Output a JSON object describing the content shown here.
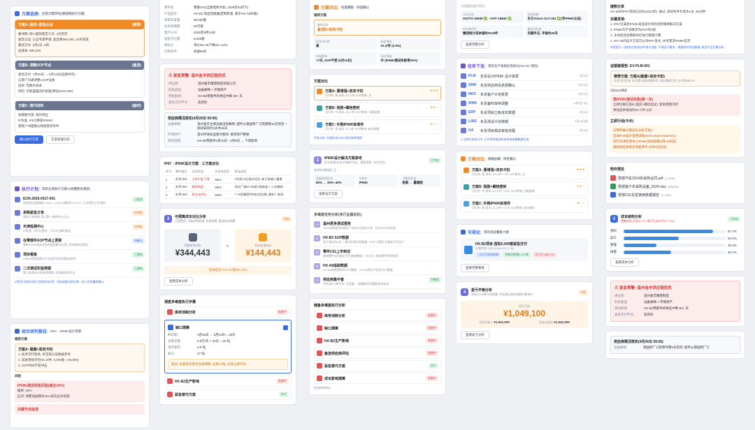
{
  "col1": {
    "schemes": {
      "title": "方案选择:",
      "subtitle": "应急方案评估(请选择执行方案)",
      "a": {
        "title": "方案A: 稳定+紧急认证",
        "badge": "(推荐)",
        "items": [
          "缓冲期: 四川晨阳稳定三天, 2天到货",
          "紧急认证: 认证专家申请, 加急费¥50,000, 30天完成",
          "最佳交付: 6月1日, 5周",
          "总成本: ¥80,200"
        ]
      },
      "b": {
        "title": "方案B: 调整SOP节点",
        "badge": "(备选)",
        "items": [
          "紧急交付: 7月30日 → 8月15日(延期半月)",
          "与客户沟通调整LSOP设备",
          "成本: 无额外成本",
          "风险: 可能面临违约索赔(预估¥100,000)"
        ]
      },
      "c": {
        "title": "方案C: 替代材料",
        "badge": "(临时)",
        "items": [
          "短期替代源: 海外供应",
          "IP标准: IP67(降级IP69K)",
          "需客户书面确认降级接受条件"
        ]
      },
      "confirm": "确认执行方案",
      "compare": "方案智能比较"
    },
    "tasks": {
      "title": "执行计划:",
      "subtitle": "项目立项执行方案A(如需更多请求)",
      "items": [
        {
          "name": "ECN-2026-0317-001",
          "desc": "热处理过程规格(0.6mm→0.5mm)需进ECR-001, 工艺规范工艺流程",
          "badge": "已批准",
          "color": "bg-green"
        },
        {
          "name": "采购紧急订单",
          "desc": "紧急订单采购-用于第一批样件(3.5万)",
          "badge": "待审批",
          "color": "bg-orange"
        },
        {
          "name": "天津检测中心",
          "desc": "IP检测: 7月6日提测 · 7月25日拿到报告",
          "badge": "待审批",
          "color": "bg-orange"
        },
        {
          "name": "在零部件SOP节点上更新",
          "desc": "更新IP69K测试计划并组织解决方案, 评估影响后提交",
          "badge": "待确认",
          "color": "bg-blue"
        },
        {
          "name": "项目看板",
          "desc": "IP69K测试结果对于外协件发货的影响说明",
          "badge": "已更新",
          "color": "bg-green"
        },
        {
          "name": "二次测试实验排期",
          "desc": "第二轮测试计划安排排期, 验证新检测方法",
          "badge": "已更新",
          "color": "bg-green"
        }
      ],
      "footer": "#项目已经执行的已完成任务3项 · 总体进度当前计划 · 进入完成最终确认"
    },
    "report": {
      "title": "综合研判报告:",
      "subtitle": "IP67→IP69K设计变更",
      "rec_label": "推荐方案",
      "rec_title": "方案A: 稳健+双向卡扣",
      "rec_items": [
        "1. 技术可行性高, 有实际认证数据参考",
        "2. 成本增加可控(¥1.2/件, 5,000套 ≈ ¥6,000)",
        "3. SOP时间不受冲击"
      ],
      "risk_label": "风险",
      "risk1_title": "IP69K测试失败风险(高达20%)",
      "risk1_items": [
        "概率: 20%",
        "应对: 调整加固模块40%成功应对措施"
      ],
      "risk2_title": "关键节点延误"
    }
  },
  "col2": {
    "params": [
      {
        "k": "零件名",
        "v": "零部C01(全新结构卡扣, 2026年01月下)"
      },
      {
        "k": "产品型号",
        "v": "HX-B2 高压连接器(定制开发, 基于HX-A8升级)"
      },
      {
        "k": "项目年度量",
        "v": "80,000套"
      },
      {
        "k": "生命周期量",
        "v": "50万套"
      },
      {
        "k": "量产SOP",
        "v": "2026年8月15日"
      },
      {
        "k": "首批交付量",
        "v": "5,000套"
      },
      {
        "k": "目标价",
        "v": "单价¥X-A8下降5%~12%"
      },
      {
        "k": "付款条件",
        "v": "验收60天"
      }
    ],
    "alert": {
      "title": "紧急预警: 温州金丰供应链危机",
      "rows": [
        {
          "k": "供应商:",
          "v": "温州金丰精密制造有限公司"
        },
        {
          "k": "危机类型:",
          "v": "设备故障 + 环保停产"
        },
        {
          "k": "预估影响:",
          "v": "HX-B2零部件的供应中断 50+ 天"
        },
        {
          "k": "紧急交付节点:",
          "v": "高风险"
        }
      ]
    },
    "status": {
      "title": "供应商情况核实(4月26日 09:05)",
      "rows": [
        {
          "k": "设备故障:",
          "v": "温州金丰主要设备出现故障, 配件从德国原厂订购需要15天到货 + 调试安装约3天共36天"
        },
        {
          "k": "环保停产:",
          "v": "温州环保局监管令暂停, 要求停产整顿"
        },
        {
          "k": "影响范围:",
          "v": "HX-B2零部件4月19日 · 5月6日 → 下线影响"
        }
      ]
    },
    "compare": {
      "title": "IP67→IP69K设计方案 · 三方案对比",
      "headers": [
        "序号",
        "零件编号",
        "当前状态",
        "供应商类型",
        "影响说明"
      ],
      "rows": [
        [
          "1",
          "外壳-001",
          "主体产能下滑",
          "MEG",
          "4号线+0主线口径异, 新订单输入量增"
        ],
        [
          "2",
          "外壳-002",
          "精密铸造",
          "MEG",
          "四太厂调M-A6进行装饰面 + 二次精修"
        ],
        [
          "3",
          "外壳-003",
          "原全成供应",
          "MRG",
          "广州铝精密件供料交货期, 需补7, 新采"
        ]
      ]
    },
    "cost": {
      "num": "3",
      "title": "与预算成本对比分析",
      "subtitle": "主要费用: 设备采购新增, 质量预算, 管理成本预算",
      "badge": "待定",
      "budget_label": "预算参考成本",
      "budget": "¥344,443",
      "actual_label": "实际变更成本",
      "actual": "¥144,443",
      "diff": "成本超支 ¥44.29/套(84.4%)",
      "btn": "查看成本分析"
    },
    "flow": {
      "title": "调度多维度执行步骤",
      "steps": [
        {
          "name": "库存消耗分析",
          "badge": "准备中",
          "color": "bg-red"
        },
        {
          "name": "缺口测算",
          "badge": "",
          "color": "bg-blue"
        }
      ],
      "detail": [
        {
          "k": "断料期:",
          "v": "4月26日 → 6月10日 = 30天"
        },
        {
          "k": "总需求量:",
          "v": "0.9万/天 × 33天 = 30 吨"
        },
        {
          "k": "现有库存:",
          "v": "3.0 吨"
        },
        {
          "k": "缺口:",
          "v": "27 吨"
        }
      ],
      "warn": "建议: 恢复现有库存设备预期, 启始17吨, 必须立即行动",
      "more": [
        {
          "name": "HX-B2生产影响",
          "badge": "准备中",
          "color": "bg-red"
        },
        {
          "name": "紧急替代方案",
          "badge": "执行",
          "color": "bg-green"
        }
      ]
    }
  },
  "col3": {
    "compare": {
      "title": "方案对比:",
      "subtitle": "标准模板 · 待选确认",
      "rec_label": "推荐方案",
      "rec_box": "备份设计",
      "rec_box2": "备选B+双向卡扣",
      "cells": [
        {
          "k": "技术可行性",
          "v": "高"
        },
        {
          "k": "成本增加",
          "v": "¥1.2/件 (3.0%)"
        },
        {
          "k": "时间影响",
          "v": "+7天, SOP不受 (5月15日)"
        },
        {
          "k": "风险等级",
          "v": "中 (IP69K测试失败率20%)"
        }
      ]
    },
    "options": {
      "title": "方案对比",
      "items": [
        {
          "name": "方案A: 重增强+双向卡扣",
          "meta": "可行性: 高  成本: ¥1.2/件  SOP影响: 无",
          "stars": "★★★",
          "hl": true
        },
        {
          "name": "方案B: 硅胶+螺栓密封",
          "meta": "可行性: 中  成本: ¥1.2/件  SOP影响: 可能延期",
          "stars": "★★☆",
          "hl": false
        },
        {
          "name": "方案C: 外购IP69K标准件",
          "meta": "可行性: 高  成本: ¥1.5件  SOP影响: 成本规模",
          "stars": "★☆☆",
          "hl": false
        }
      ],
      "link": "开发分析: 扫描车风IP69K项目参考案例"
    },
    "design": {
      "num": "1",
      "title": "IP69K设计解决方案参考",
      "subtitle": "四大来源(车风/外链研讨会)  · 直接采购  · 技术文档",
      "badge": "已完成",
      "ref_label": "参考检测数据汇总",
      "cells": [
        {
          "k": "温度测试区间",
          "v": "80% → 30%~40%"
        },
        {
          "k": "IP防护",
          "v": "IP69K"
        },
        {
          "k": "可靠性验证",
          "v": "组装 → 量端组"
        }
      ],
      "btn": "查看设计方案"
    },
    "steps": {
      "title": "多维度任务分析(多行业版对比)",
      "items": [
        {
          "n": "01",
          "name": "温州更多测试报告",
          "desc": "2026年新闻分析报告一体化2次测试分享 · 日均5K节点状态",
          "badge": ""
        },
        {
          "n": "02",
          "name": "HX-B2 SOP数据",
          "desc": "生产线8月15日 + 通过年到风险数据 · SOP 日期无为相关平均生产",
          "badge": ""
        },
        {
          "n": "03",
          "name": "零件C01上市到访",
          "desc": "查询零件访问报价平台查询数据 · 7月9日 | 现有零件等待检测",
          "badge": ""
        },
        {
          "n": "04",
          "name": "HX-A8追踪数据",
          "desc": "HX-A8研发期间可IP67数据 · HX-A8原生产验证IP67数据",
          "badge": ""
        },
        {
          "n": "05",
          "name": "供应商集中查",
          "desc": "中达4的订单平台, 可设备7 · 把握新资讯需要发布成本",
          "badge": "完整版"
        }
      ]
    },
    "analysis": {
      "title": "储备多维度执行分析",
      "items": [
        {
          "name": "库存消耗分析",
          "badge": "准备中",
          "color": "bg-red"
        },
        {
          "name": "缺口测算",
          "badge": "准备中",
          "color": "bg-red"
        },
        {
          "name": "HX-B2生产影响",
          "badge": "准备中",
          "color": "bg-red"
        },
        {
          "name": "备选供应商评估",
          "badge": "准备中",
          "color": "bg-red"
        },
        {
          "name": "紧急替代方案",
          "badge": "执行",
          "color": "bg-green"
        },
        {
          "name": "成本影响测算",
          "badge": "准备中",
          "color": "bg-red"
        }
      ],
      "footer": "综合研判结论"
    }
  },
  "col4": {
    "cert": {
      "title": "认证备案(国外项目)",
      "cells": [
        {
          "k": "认证状态",
          "v": "ISO/TS 16949 ✅ · IATF 16949 ✅"
        },
        {
          "k": "检测设备",
          "v": "东方Vision GLT-401 ✅(华IP69K认证)"
        },
        {
          "k": "供应商评估",
          "v": "集团统计成本值约¥0.8/件"
        },
        {
          "k": "最优供应商",
          "v": "无额外支, 平省约20天"
        }
      ],
      "btn": "查看完整分析"
    },
    "tasks": {
      "title": "任务下发:",
      "subtitle": "项目生产系统任务拆分(HX-B2 项目)",
      "items": [
        {
          "sys": "PLM",
          "desc": "负责设计IP69K 设计变更",
          "date": "6月5日"
        },
        {
          "sys": "SRM",
          "desc": "负责供应商信息部确认",
          "date": "5月15日"
        },
        {
          "sys": "MES",
          "desc": "负责客户计划变更",
          "date": "5月20日"
        },
        {
          "sys": "WMS",
          "desc": "负责备料库存调整",
          "date": "5月5日-9日"
        },
        {
          "sys": "ERP",
          "desc": "负责项目立新成本数据",
          "date": "5月4日"
        },
        {
          "sys": "LIMS",
          "desc": "负责测试计划排期",
          "date": "6月20日前"
        },
        {
          "sys": "OA",
          "desc": "负责项目相关审批流程",
          "date": "5月3日"
        }
      ],
      "footer": "# 当前任务执行中, 正在等待推送所有系统准确数据生效"
    },
    "compare2": {
      "title": "方案对比:",
      "subtitle": "稍候加载 · 待定确认",
      "items": [
        {
          "name": "方案A: 重增强+双向卡扣",
          "meta": "可行性: 高  成本: ¥1.2/件  +7天  SOP影响: 无",
          "stars": "★★★"
        },
        {
          "name": "方案B: 硅胶+螺栓密封",
          "meta": "可行性: 中  成本: ¥1.2/件  +14天  SOP影响: 可能延期",
          "stars": "★★☆"
        },
        {
          "name": "方案C: 外购IP69K标准件",
          "meta": "可行性: 高  成本: ¥1.5/件  +21天  SOP影响: 成本增长",
          "stars": "★☆☆"
        }
      ]
    },
    "viz": {
      "title": "可视化:",
      "subtitle": "项目发送看板大屏",
      "proj": "HX-B2项目·首批5,000套紧急交付",
      "meta": "计划时间: 9天 (2026.4.22-7.30)",
      "tags": [
        "7天后可完成结果",
        "到期总数量5,000套",
        "压力大 (86/100)"
      ],
      "btn": "查看完整看板"
    },
    "profit": {
      "num": "4",
      "title": "盈亏平衡分析",
      "subtitle": "首批5,000套为例核算, 目标通过成本差额计算单价",
      "badge": "中级",
      "label": "项目亏损",
      "value": "¥1,049,100",
      "left_k": "实际总收入",
      "left_v": "¥1,041,000",
      "right_k": "实际总成本",
      "right_v": "¥1,041,000",
      "btn": "查看盈亏分析"
    }
  },
  "col5": {
    "summary": {
      "title": "链数分享",
      "text": "HX-B2的IP67测试已达标(2024年), 通过, 测试条件为温水1米, 30分钟",
      "key_title": "关键发现:",
      "keys": [
        "1. IP67已满足IP69K高压喷水等检测项需要解决方案",
        "2. IP69K的产测要求为IP67的3倍",
        "3. 主体结合处需要布控进行模量计算",
        "4. HX-A8的设计方案可以对IP67变化, 失考需求IP69K变求"
      ],
      "note": "风险提示: 当前车应的测试环境与功能, 不满足行需求。根据条件测试数据, 来完不全打模分析"
    },
    "ecn": {
      "title": "证据链报告: EV-PLM-001",
      "rec": "推荐方案: 方案A(稳健+双向卡扣)",
      "rec_desc": "技术可行性高, 有可靠/长期成果参考; 成本增幅可控; 也不影响SOP",
      "risk_label": "风险应对预案",
      "risk": "若IP69K测试失败(第一次)",
      "risk_items": [
        "立即切换方案B (硅胶+螺栓固化): 影响增量可控",
        "预估成本增加约¥0.7/件 (5天"
      ]
    },
    "actions": {
      "title": "立即行动(今天)",
      "items": [
        "与零件确认模态化分析方案A",
        "启动PLM设计变更流程(ECN-2026-0425-001)",
        "同行天津检测中心IP69K测试排期(5月10日前)",
        "通知供应商采买调查清单 (5月5日启动)"
      ]
    },
    "files": {
      "title": "附件预览",
      "items": [
        {
          "name": "零部汽车2024年采购合同.pdf",
          "size": "(2.3MB)",
          "color": "#e05555"
        },
        {
          "name": "零部客户年采购设备_2024.xlsx",
          "size": "(856KB)",
          "color": "#2d9a56"
        },
        {
          "name": "零部C01车型使用数据报告",
          "size": "(1.1MB)",
          "color": "#3a6ae0"
        }
      ]
    },
    "chart": {
      "num": "2",
      "title": "成本结构分析",
      "subtitle": "预算成本占比60.7%, 高于行业水平(12~3%)",
      "badge": "已完成",
      "btn": "查看成本分析"
    },
    "alert": {
      "title": "紧急预警: 温州金丰供应链危机",
      "rows": [
        {
          "k": "供应商:",
          "v": "温州金丰精密制造"
        },
        {
          "k": "危机类型:",
          "v": "设备故障 + 环保停产"
        },
        {
          "k": "预估影响:",
          "v": "HX-B2零部件的供应中断 50+ 天"
        },
        {
          "k": "紧急交付节点:",
          "v": "高风险"
        }
      ]
    },
    "status": {
      "title": "供应商情况核实(4月26日 09:05)",
      "row_k": "设备故障:",
      "row_v": "德国原厂订购零件需5天到货; 配件从德国原厂订"
    }
  },
  "chart_data": {
    "type": "bar",
    "categories": [
      "材料",
      "加工",
      "管理",
      "质量"
    ],
    "values": [
      87.7,
      54.2,
      32.3,
      46.7
    ],
    "unit": "%",
    "title": "成本结构分析"
  },
  "colors": {
    "accent": "#3a6ae0",
    "orange": "#f08a24",
    "red": "#d43f3f",
    "green": "#2d9a56",
    "purple": "#6b4fd6"
  }
}
